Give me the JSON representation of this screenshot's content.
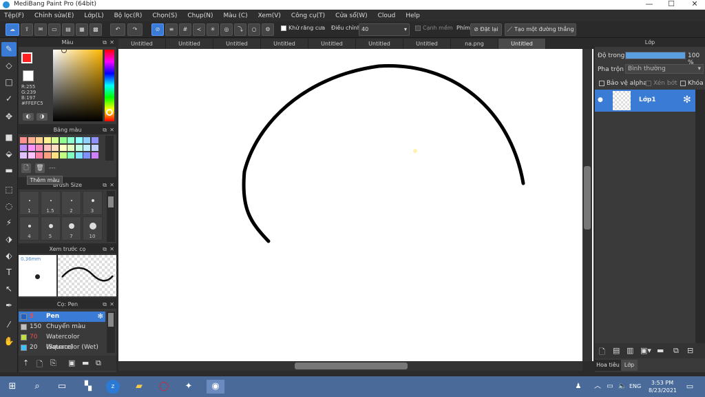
{
  "window": {
    "title": "MediBang Paint Pro (64bit)",
    "minimize": "—",
    "maximize": "☐",
    "close": "✕"
  },
  "menu": [
    "Tệp(F)",
    "Chỉnh sửa(E)",
    "Lớp(L)",
    "Bộ lọc(R)",
    "Chọn(S)",
    "Chụp(N)",
    "Màu (C)",
    "Xem(V)",
    "Công cụ(T)",
    "Cửa sổ(W)",
    "Cloud",
    "Help"
  ],
  "toolbar": {
    "antialias_label": "Khử răng cưa",
    "adjust_label": "Điều chỉnh",
    "adjust_value": "40",
    "edge_label": "Cạnh mềm",
    "key_label": "Phím",
    "reset_label": "Đặt lại",
    "straight_label": "Tạo một đường thẳng"
  },
  "color_panel": {
    "title": "Màu",
    "r": "R:255",
    "g": "G:239",
    "b": "B:197",
    "hex": "#FFEFC5",
    "primary_color": "#ff2020",
    "secondary_color": "#ffffff"
  },
  "swatch_panel": {
    "title": "Bảng màu",
    "tooltip": "Thêm màu",
    "hint": "---",
    "colors": [
      "#ff9090",
      "#ffb090",
      "#ffd090",
      "#fff090",
      "#d0ff90",
      "#90ff90",
      "#90ffd0",
      "#90ffff",
      "#90d0ff",
      "#9090ff",
      "#c090ff",
      "#ff90ff",
      "#ff90c0",
      "#ffc0c0",
      "#ffe0c0",
      "#ffffc0",
      "#e0ffc0",
      "#c0ffe0",
      "#c0f0ff",
      "#c0d0ff",
      "#e0c0ff",
      "#ffc0ff",
      "#ff80a0",
      "#ffa080",
      "#ffe080",
      "#c0ff80",
      "#80ffc0",
      "#80e0ff",
      "#8090ff",
      "#d080ff"
    ]
  },
  "brush_size_panel": {
    "title": "Brush Size",
    "sizes": [
      "1",
      "1.5",
      "2",
      "3",
      "4",
      "5",
      "7",
      "10"
    ]
  },
  "preview_panel": {
    "title": "Xem trước cọ",
    "size": "0.36mm"
  },
  "brush_panel": {
    "title": "Cọ: Pen",
    "items": [
      {
        "size": "5",
        "name": "Pen",
        "color": "#2060c0"
      },
      {
        "size": "150",
        "name": "Chuyển màu",
        "color": "#c0c0c0"
      },
      {
        "size": "70",
        "name": "Watercolor (Square)",
        "color": "#c0e040"
      },
      {
        "size": "20",
        "name": "Watercolor (Wet)",
        "color": "#40c0ff"
      }
    ]
  },
  "tabs": [
    "Untitled",
    "Untitled",
    "Untitled",
    "Untitled",
    "Untitled",
    "Untitled",
    "Untitled",
    "na.png",
    "Untitled"
  ],
  "layer_panel": {
    "title": "Lớp",
    "opacity_label": "Độ trong",
    "opacity_value": "100 %",
    "opacity": 1.0,
    "blend_label": "Pha trộn",
    "blend_value": "Bình thường",
    "protect_alpha": "Bảo vệ alpha",
    "clipping": "Xén bớt",
    "lock": "Khóa",
    "layer_name": "Lớp1",
    "bottom_tabs": [
      "Hoa tiêu",
      "Lớp"
    ]
  },
  "taskbar": {
    "lang": "ENG",
    "time": "3:53 PM",
    "date": "8/23/2021"
  }
}
